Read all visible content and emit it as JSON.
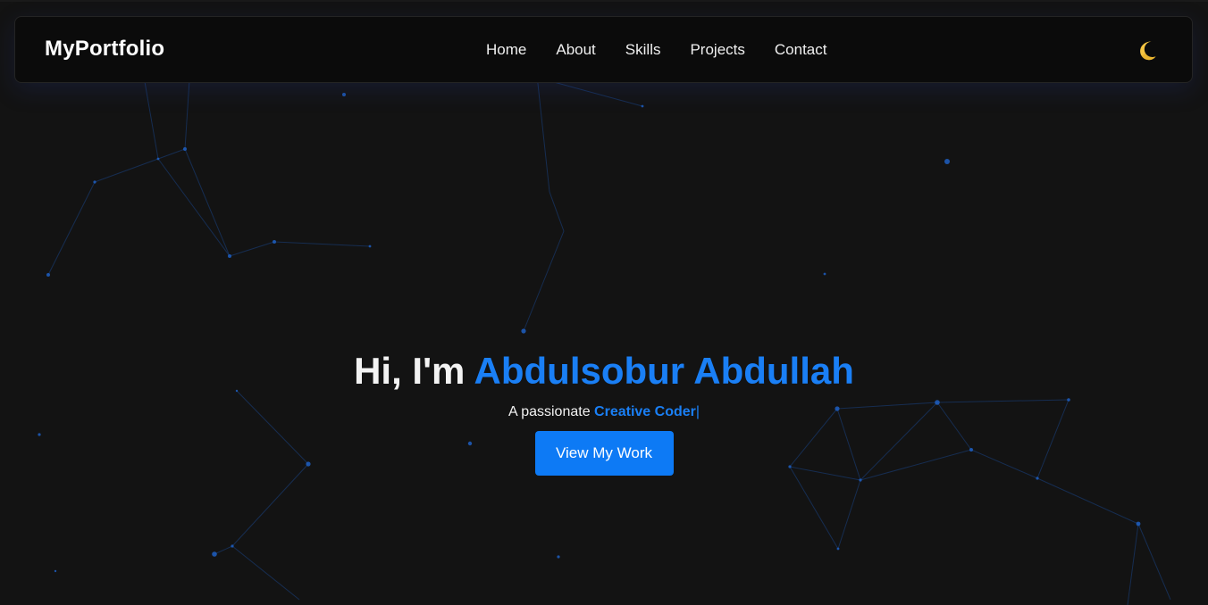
{
  "navbar": {
    "brand": "MyPortfolio",
    "links": [
      "Home",
      "About",
      "Skills",
      "Projects",
      "Contact"
    ],
    "theme_toggle_icon": "crescent-moon-icon"
  },
  "hero": {
    "greeting": "Hi, I'm ",
    "name": "Abdulsobur Abdullah",
    "tagline_prefix": "A passionate ",
    "tagline_role": "Creative Coder",
    "cursor": "|",
    "cta_label": "View My Work"
  },
  "colors": {
    "background": "#131313",
    "navbar": "#0b0b0b",
    "accent": "#1a7ff5",
    "button": "#0d7af5",
    "particles": "#1f5fc2",
    "moon": "#f5c542"
  },
  "background_effect": "particle-network"
}
